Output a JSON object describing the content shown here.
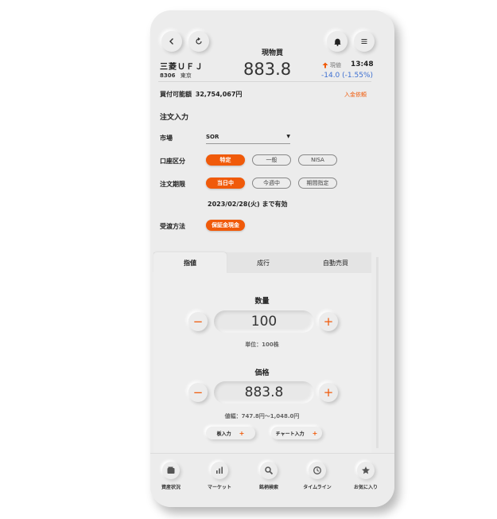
{
  "header": {
    "title": "現物買",
    "back_icon": "chevron-left-icon",
    "refresh_icon": "refresh-icon",
    "bell_icon": "bell-icon",
    "menu_icon": "menu-icon"
  },
  "stock": {
    "name": "三菱ＵＦＪ",
    "code": "8306",
    "exchange": "東京",
    "price": "883.8",
    "price_type": "現値",
    "time": "13:48",
    "change": "-14.0 (-1.55%)"
  },
  "account": {
    "buying_power_label": "買付可能額",
    "buying_power_value": "32,754,067円",
    "deposit_link": "入金依頼"
  },
  "order_form": {
    "section_title": "注文入力",
    "market_label": "市場",
    "market_value": "SOR",
    "account_type_label": "口座区分",
    "account_types": [
      "特定",
      "一般",
      "NISA"
    ],
    "account_type_selected": "特定",
    "period_label": "注文期限",
    "periods": [
      "当日中",
      "今週中",
      "期間指定"
    ],
    "period_selected": "当日中",
    "valid_until": "2023/02/28(火) まで有効",
    "settlement_label": "受渡方法",
    "settlement_value": "保証金現金"
  },
  "tabs": [
    {
      "label": "指値",
      "active": true
    },
    {
      "label": "成行",
      "active": false
    },
    {
      "label": "自動売買",
      "active": false
    }
  ],
  "quantity": {
    "label": "数量",
    "value": "100",
    "unit_hint": "単位：100株",
    "minus": "−",
    "plus": "+"
  },
  "price_input": {
    "label": "価格",
    "value": "883.8",
    "range_hint": "値幅：747.8円〜1,048.0円",
    "minus": "−",
    "plus": "+"
  },
  "quick_buttons": {
    "board_input": "板入力",
    "chart_input": "チャート入力",
    "plus": "+"
  },
  "bottom_nav": [
    {
      "label": "資産状況",
      "icon": "wallet-icon"
    },
    {
      "label": "マーケット",
      "icon": "bar-chart-icon"
    },
    {
      "label": "銘柄検索",
      "icon": "search-icon"
    },
    {
      "label": "タイムライン",
      "icon": "clock-icon"
    },
    {
      "label": "お気に入り",
      "icon": "star-icon"
    }
  ],
  "colors": {
    "accent": "#f05a0a",
    "change_negative": "#3d6fd1",
    "background": "#ececec"
  }
}
